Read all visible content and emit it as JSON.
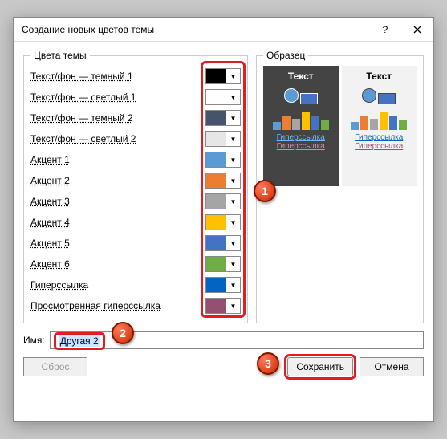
{
  "dialog": {
    "title": "Создание новых цветов темы",
    "group_colors": "Цвета темы",
    "group_sample": "Образец",
    "name_label": "Имя:",
    "name_value": "Другая 2",
    "btn_reset": "Сброс",
    "btn_save": "Сохранить",
    "btn_cancel": "Отмена"
  },
  "rows": [
    {
      "label": "Текст/фон — темный 1",
      "color": "#000000"
    },
    {
      "label": "Текст/фон — светлый 1",
      "color": "#ffffff"
    },
    {
      "label": "Текст/фон — темный 2",
      "color": "#44546a"
    },
    {
      "label": "Текст/фон — светлый 2",
      "color": "#e7e6e6"
    },
    {
      "label": "Акцент 1",
      "color": "#5b9bd5"
    },
    {
      "label": "Акцент 2",
      "color": "#ed7d31"
    },
    {
      "label": "Акцент 3",
      "color": "#a5a5a5"
    },
    {
      "label": "Акцент 4",
      "color": "#ffc000"
    },
    {
      "label": "Акцент 5",
      "color": "#4472c4"
    },
    {
      "label": "Акцент 6",
      "color": "#70ad47"
    },
    {
      "label": "Гиперссылка",
      "color": "#0563c1"
    },
    {
      "label": "Просмотренная гиперссылка",
      "color": "#954f72"
    }
  ],
  "sample": {
    "text_label": "Текст",
    "link": "Гиперссылка",
    "visited": "Гиперссылка"
  },
  "markers": {
    "m1": "1",
    "m2": "2",
    "m3": "3"
  }
}
